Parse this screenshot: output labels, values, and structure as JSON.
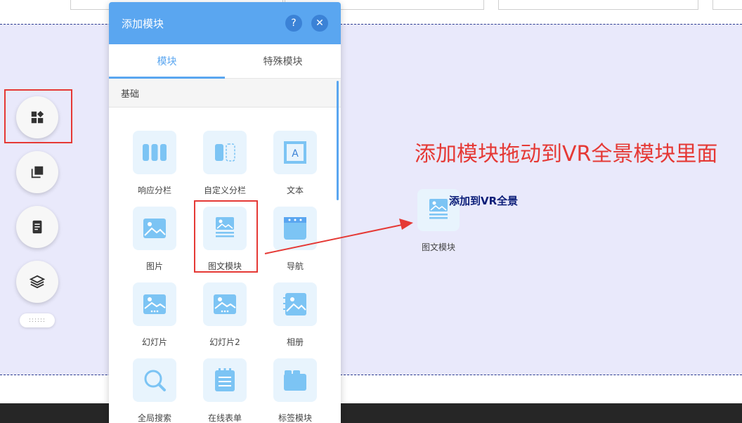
{
  "panel": {
    "title": "添加模块",
    "help_icon": "question-icon",
    "close_icon": "close-icon",
    "tabs": [
      {
        "label": "模块",
        "active": true
      },
      {
        "label": "特殊模块",
        "active": false
      }
    ],
    "section": "基础",
    "modules": [
      {
        "label": "响应分栏",
        "icon": "columns-icon"
      },
      {
        "label": "自定义分栏",
        "icon": "custom-columns-icon"
      },
      {
        "label": "文本",
        "icon": "text-icon"
      },
      {
        "label": "图片",
        "icon": "image-icon"
      },
      {
        "label": "图文模块",
        "icon": "image-text-icon"
      },
      {
        "label": "导航",
        "icon": "nav-icon"
      },
      {
        "label": "幻灯片",
        "icon": "slideshow-icon"
      },
      {
        "label": "幻灯片2",
        "icon": "slideshow2-icon"
      },
      {
        "label": "相册",
        "icon": "album-icon"
      },
      {
        "label": "全局搜索",
        "icon": "search-icon"
      },
      {
        "label": "在线表单",
        "icon": "form-icon"
      },
      {
        "label": "标签模块",
        "icon": "tabs-module-icon"
      }
    ]
  },
  "toolbar": {
    "buttons": [
      "add-module-icon",
      "copy-icon",
      "page-icon",
      "layers-icon"
    ],
    "drag_handle": "::::::"
  },
  "canvas": {
    "instruction": "添加模块拖动到VR全景模块里面",
    "drop_hint": "添加到VR全景",
    "dragged_label": "图文模块"
  },
  "colors": {
    "accent": "#5aa6f0",
    "annotation": "#e53935",
    "canvas_bg": "#e9e9fb"
  }
}
